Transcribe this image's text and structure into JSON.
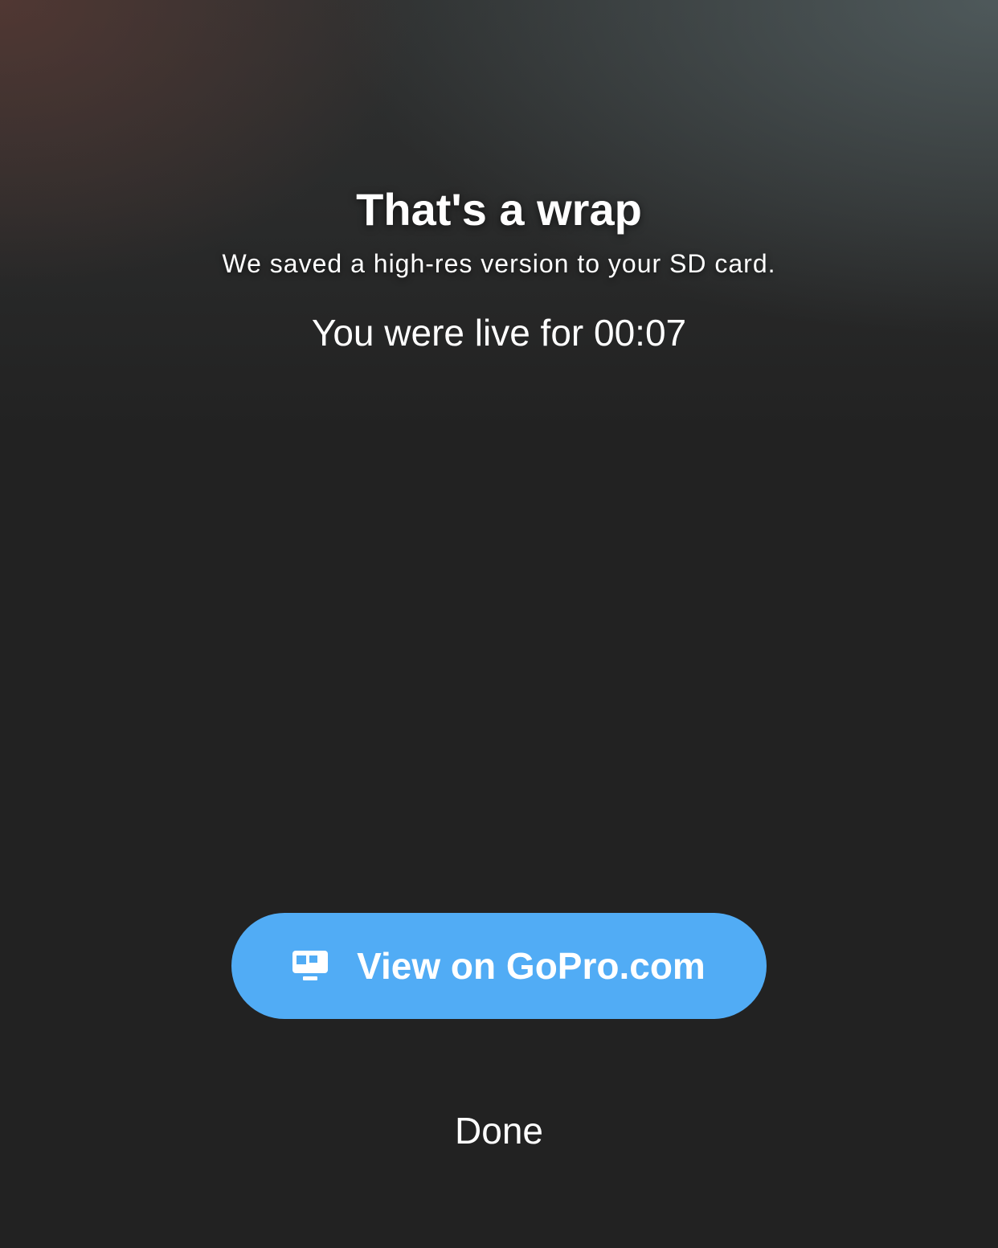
{
  "summary": {
    "title": "That's a wrap",
    "subtitle": "We saved a high-res version to your SD card.",
    "live_duration_text": "You were live for 00:07"
  },
  "actions": {
    "view_button": {
      "label": "View on GoPro.com",
      "icon": "gopro-camera-icon",
      "color": "#51acf5"
    },
    "done_label": "Done"
  },
  "theme": {
    "background": "#222222",
    "text": "#ffffff"
  }
}
